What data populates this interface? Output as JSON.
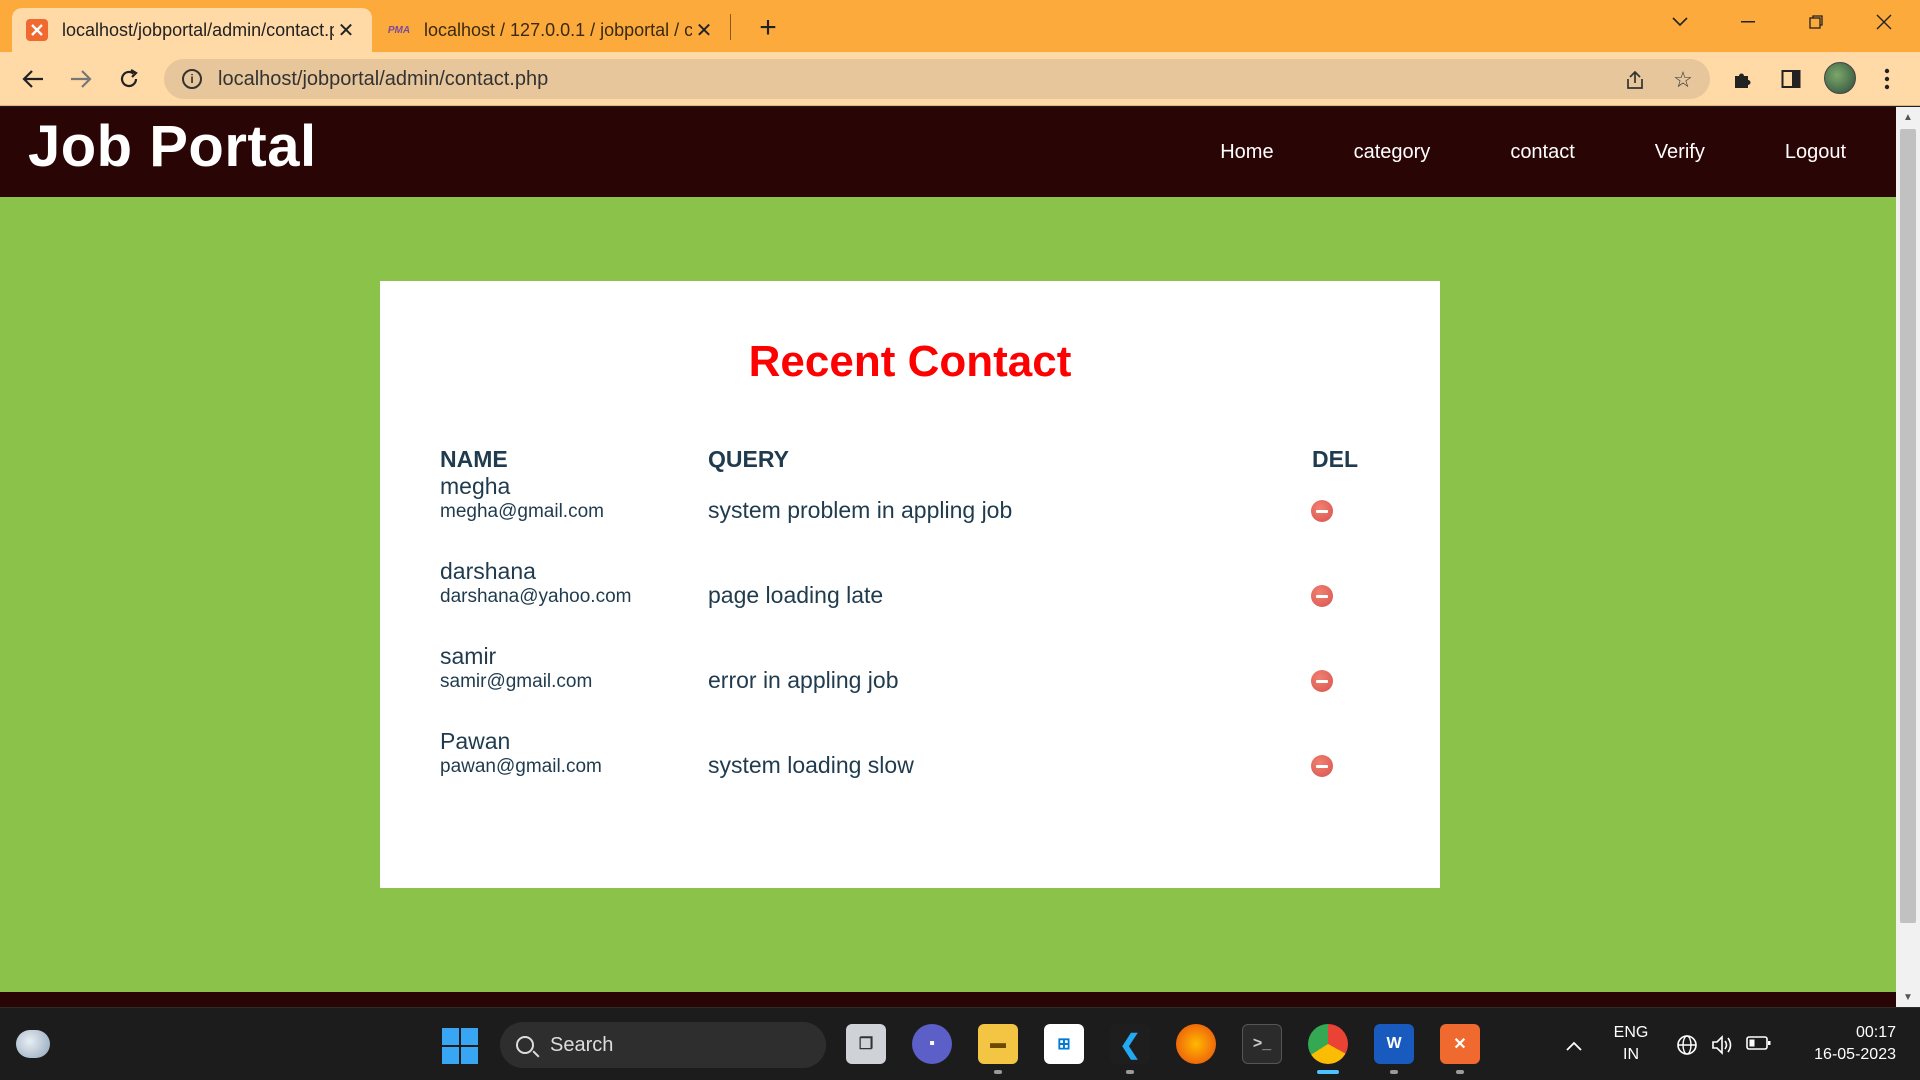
{
  "browser": {
    "tabs": [
      {
        "title": "localhost/jobportal/admin/contact.php",
        "active": true,
        "favicon": "xampp-icon"
      },
      {
        "title": "localhost / 127.0.0.1 / jobportal / contact",
        "active": false,
        "favicon": "phpmyadmin-icon",
        "favicon_text": "PMA"
      }
    ],
    "new_tab_label": "+",
    "url": "localhost/jobportal/admin/contact.php",
    "colors": {
      "frame": "#fdaa3c",
      "toolbar": "#ffd9a6"
    }
  },
  "site": {
    "brand": "Job Portal",
    "nav": [
      "Home",
      "category",
      "contact",
      "Verify",
      "Logout"
    ],
    "colors": {
      "header": "#2a0505",
      "page_bg": "#8bc34a",
      "title": "#ff0000",
      "text": "#1f3b4d"
    }
  },
  "contacts": {
    "title": "Recent Contact",
    "headers": {
      "name": "NAME",
      "query": "QUERY",
      "del": "DEL"
    },
    "rows": [
      {
        "name": "megha",
        "email": "megha@gmail.com",
        "query": "system problem in appling job"
      },
      {
        "name": "darshana",
        "email": "darshana@yahoo.com",
        "query": "page loading late"
      },
      {
        "name": "samir",
        "email": "samir@gmail.com",
        "query": "error in appling job"
      },
      {
        "name": "Pawan",
        "email": "pawan@gmail.com",
        "query": "system loading slow"
      }
    ]
  },
  "taskbar": {
    "search_label": "Search",
    "language": "ENG",
    "region": "IN",
    "time": "00:17",
    "date": "16-05-2023"
  }
}
